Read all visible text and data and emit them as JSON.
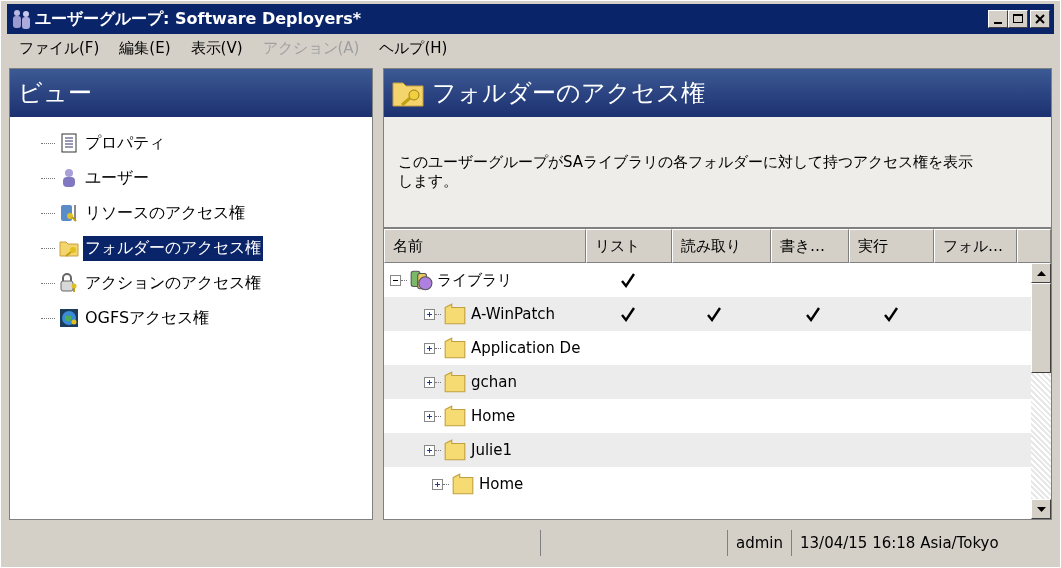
{
  "window": {
    "title": "ユーザーグループ: Software Deployers*"
  },
  "menu": [
    {
      "label": "ファイル(F)",
      "disabled": false
    },
    {
      "label": "編集(E)",
      "disabled": false
    },
    {
      "label": "表示(V)",
      "disabled": false
    },
    {
      "label": "アクション(A)",
      "disabled": true
    },
    {
      "label": "ヘルプ(H)",
      "disabled": false
    }
  ],
  "sidebar": {
    "title": "ビュー",
    "items": [
      {
        "label": "プロパティ",
        "kind": "document",
        "selected": false
      },
      {
        "label": "ユーザー",
        "kind": "user",
        "selected": false
      },
      {
        "label": "リソースのアクセス権",
        "kind": "server",
        "selected": false
      },
      {
        "label": "フォルダーのアクセス権",
        "kind": "folder",
        "selected": true
      },
      {
        "label": "アクションのアクセス権",
        "kind": "lock",
        "selected": false
      },
      {
        "label": "OGFSアクセス権",
        "kind": "globe",
        "selected": false
      }
    ]
  },
  "content": {
    "title": "フォルダーのアクセス権",
    "description": "このユーザーグループがSAライブラリの各フォルダーに対して持つアクセス権を表示します。",
    "table": {
      "columns": [
        "名前",
        "リスト",
        "読み取り",
        "書き…",
        "実行",
        "フォル…"
      ],
      "rows": [
        {
          "name": "ライブラリ",
          "kind": "library",
          "expanded": true,
          "permissions": [
            true,
            false,
            false,
            false,
            false
          ],
          "children": [
            {
              "name": "A-WinPatch",
              "kind": "folder",
              "expanded": false,
              "permissions": [
                true,
                true,
                true,
                true,
                false
              ]
            },
            {
              "name": "Application De",
              "kind": "folder",
              "expanded": false,
              "permissions": [
                false,
                false,
                false,
                false,
                false
              ]
            },
            {
              "name": "gchan",
              "kind": "folder",
              "expanded": false,
              "permissions": [
                false,
                false,
                false,
                false,
                false
              ]
            },
            {
              "name": "Home",
              "kind": "folder",
              "expanded": false,
              "permissions": [
                false,
                false,
                false,
                false,
                false
              ]
            },
            {
              "name": "Julie1",
              "kind": "folder",
              "expanded": false,
              "permissions": [
                false,
                false,
                false,
                false,
                false
              ],
              "children": [
                {
                  "name": "Home",
                  "kind": "folder",
                  "expanded": false,
                  "permissions": [
                    false,
                    false,
                    false,
                    false,
                    false
                  ]
                }
              ]
            }
          ]
        }
      ]
    }
  },
  "status_bar": {
    "user": "admin",
    "time": "13/04/15 16:18 Asia/Tokyo"
  }
}
